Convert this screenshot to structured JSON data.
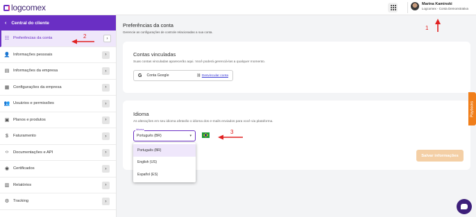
{
  "app": {
    "logo": "logcomex"
  },
  "user": {
    "name": "Marina Kaminski",
    "org": "Logcomex - Conta Demonstrativa"
  },
  "sidebar": {
    "header": "Central do cliente",
    "items": [
      {
        "label": "Preferências da conta",
        "icon": "sliders-icon",
        "glyph": "☷",
        "active": true
      },
      {
        "label": "Informações pessoais",
        "icon": "user-icon",
        "glyph": "👤"
      },
      {
        "label": "Informações da empresa",
        "icon": "document-icon",
        "glyph": "▤"
      },
      {
        "label": "Configurações da empresa",
        "icon": "building-icon",
        "glyph": "▦"
      },
      {
        "label": "Usuários e permissões",
        "icon": "users-icon",
        "glyph": "👥"
      },
      {
        "label": "Planos e produtos",
        "icon": "box-icon",
        "glyph": "▣"
      },
      {
        "label": "Faturamento",
        "icon": "dollar-icon",
        "glyph": "$"
      },
      {
        "label": "Documentações e API",
        "icon": "code-icon",
        "glyph": "‹›"
      },
      {
        "label": "Certificados",
        "icon": "certificate-icon",
        "glyph": "◉"
      },
      {
        "label": "Relatórios",
        "icon": "bar-chart-icon",
        "glyph": "▥"
      },
      {
        "label": "Tracking",
        "icon": "gear-icon",
        "glyph": "⚙"
      }
    ]
  },
  "main": {
    "title": "Preferências da conta",
    "subtitle": "Gerencie as configurações de controle relacionadas a sua conta."
  },
  "linked": {
    "title": "Contas vinculadas",
    "subtitle": "Suas contas vinculadas aparecerão aqui. Você poderá gerenciá-las a qualquer momento.",
    "account": "Conta Google",
    "unlink_prefix": "",
    "unlink_label": "Desvincular conta"
  },
  "language": {
    "title": "Idioma",
    "subtitle": "As alterações em seu idioma afetarão o idioma dos e-mails enviados para você via plataforma.",
    "field_label": "Idioma",
    "selected": "Português (BR)",
    "options": [
      "Português (BR)",
      "English (US)",
      "Español (ES)"
    ]
  },
  "save_button": "Salvar informações",
  "playbooks": "Playbooks",
  "annotations": [
    "1",
    "2",
    "3"
  ],
  "colors": {
    "accent": "#6a2fc4",
    "annotation": "#e02020",
    "save_disabled": "#f4cfa5",
    "playbooks": "#f07e1a"
  }
}
